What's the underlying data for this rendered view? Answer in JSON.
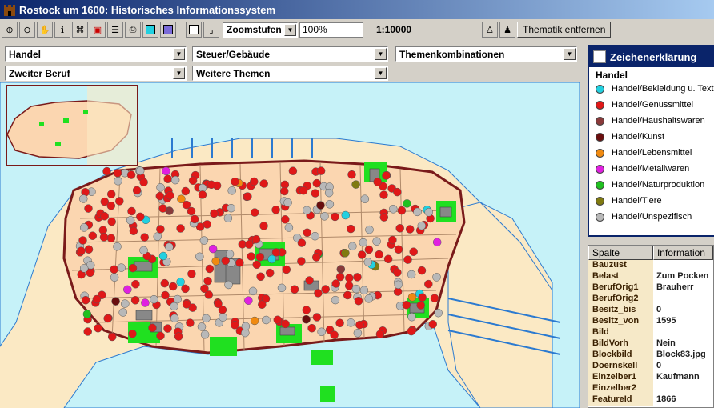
{
  "window": {
    "title": "Rostock um 1600: Historisches Informationssystem"
  },
  "toolbar": {
    "zoom_combo": "Zoomstufen",
    "zoom_percent": "100%",
    "scale": "1:10000",
    "remove_theme_button": "Thematik entfernen",
    "icons": [
      "zoom-in-icon",
      "zoom-out-icon",
      "pan-hand-icon",
      "info-icon",
      "binoculars-icon",
      "frame-icon",
      "legend-list-icon",
      "print-icon",
      "cyan-color-icon",
      "violet-color-icon"
    ]
  },
  "filters": {
    "f1": "Handel",
    "f2": "Steuer/Gebäude",
    "f3": "Themenkombinationen",
    "f4": "Zweiter Beruf",
    "f5": "Weitere Themen"
  },
  "legend": {
    "title": "Zeichenerklärung",
    "heading": "Handel",
    "items": [
      {
        "label": "Handel/Bekleidung u. Textilien",
        "color": "#22d0e0"
      },
      {
        "label": "Handel/Genussmittel",
        "color": "#e01818"
      },
      {
        "label": "Handel/Haushaltswaren",
        "color": "#8a3a3a"
      },
      {
        "label": "Handel/Kunst",
        "color": "#6a0e0e"
      },
      {
        "label": "Handel/Lebensmittel",
        "color": "#f08a10"
      },
      {
        "label": "Handel/Metallwaren",
        "color": "#e020e0"
      },
      {
        "label": "Handel/Naturproduktion",
        "color": "#20c020"
      },
      {
        "label": "Handel/Tiere",
        "color": "#807a10"
      },
      {
        "label": "Handel/Unspezifisch",
        "color": "#b8b8b8"
      }
    ]
  },
  "info": {
    "col1": "Spalte",
    "col2": "Information",
    "rows": [
      {
        "k": "Bauzust",
        "v": ""
      },
      {
        "k": "Belast",
        "v": "Zum Pocken"
      },
      {
        "k": "BerufOrig1",
        "v": "Brauherr"
      },
      {
        "k": "BerufOrig2",
        "v": ""
      },
      {
        "k": "Besitz_bis",
        "v": "0"
      },
      {
        "k": "Besitz_von",
        "v": "1595"
      },
      {
        "k": "Bild",
        "v": ""
      },
      {
        "k": "BildVorh",
        "v": "Nein"
      },
      {
        "k": "Blockbild",
        "v": "Block83.jpg"
      },
      {
        "k": "Doernskell",
        "v": "0"
      },
      {
        "k": "Einzelber1",
        "v": "Kaufmann"
      },
      {
        "k": "Einzelber2",
        "v": ""
      },
      {
        "k": "FeatureId",
        "v": "1866"
      }
    ]
  },
  "colors": {
    "water": "#c6f2f8",
    "land": "#fbe9c4",
    "city": "#fbd6b0",
    "wall": "#7a1a1a",
    "green": "#20e020",
    "building": "#888888"
  }
}
